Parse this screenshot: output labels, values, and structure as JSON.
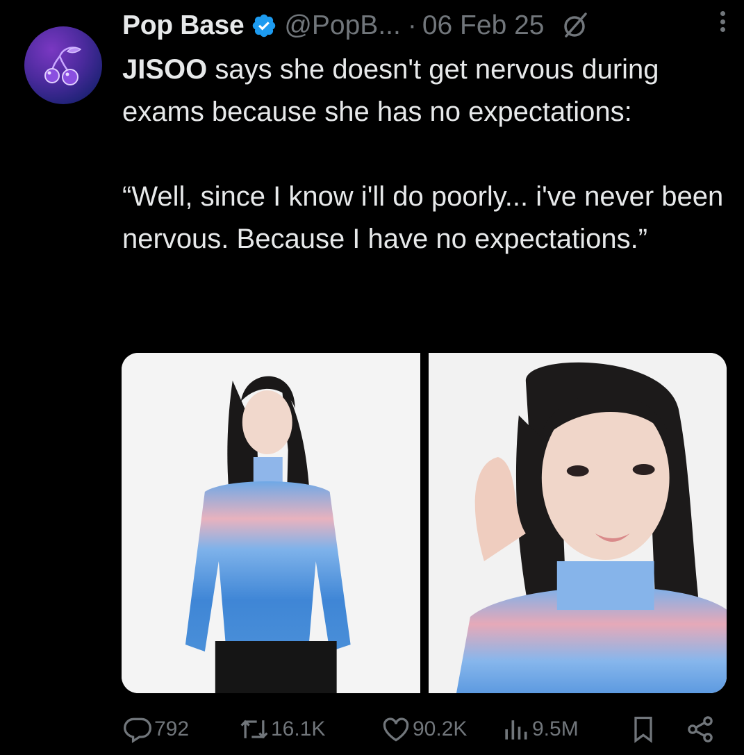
{
  "tweet": {
    "display_name": "Pop Base",
    "handle": "@PopB...",
    "separator": "·",
    "date": "06 Feb 25",
    "text": {
      "line1_bold": "JISOO",
      "line1_rest": " says she doesn't get nervous during exams because she has no expectations:",
      "quote": "“Well, since I know i'll do poorly... i've never been nervous. Because I have no expectations.”"
    }
  },
  "icons": {
    "avatar": "cherry-icon",
    "verified": "verified-badge-icon",
    "grok": "grok-icon",
    "more": "more-options-icon",
    "reply": "reply-icon",
    "repost": "repost-icon",
    "like": "like-icon",
    "views": "views-icon",
    "bookmark": "bookmark-icon",
    "share": "share-icon"
  },
  "actions": {
    "replies": "792",
    "reposts": "16.1K",
    "likes": "90.2K",
    "views": "9.5M"
  },
  "colors": {
    "background": "#000000",
    "text": "#e7e9ea",
    "muted": "#71767b",
    "verified": "#1d9bf0"
  }
}
